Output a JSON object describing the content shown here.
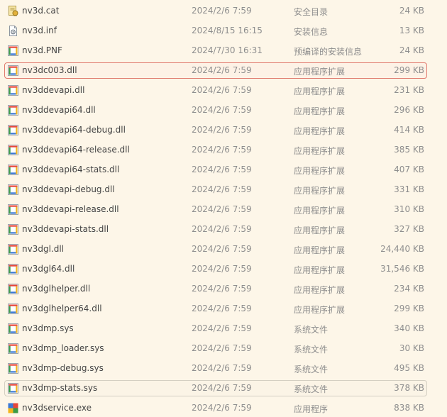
{
  "files": [
    {
      "name": "nv3d.cat",
      "date": "2024/2/6 7:59",
      "type": "安全目录",
      "size": "24 KB",
      "icon": "catalog-file-icon"
    },
    {
      "name": "nv3d.inf",
      "date": "2024/8/15 16:15",
      "type": "安装信息",
      "size": "13 KB",
      "icon": "setup-info-file-icon"
    },
    {
      "name": "nv3d.PNF",
      "date": "2024/7/30 16:31",
      "type": "预编译的安装信息",
      "size": "24 KB",
      "icon": "dll-file-icon"
    },
    {
      "name": "nv3dc003.dll",
      "date": "2024/2/6 7:59",
      "type": "应用程序扩展",
      "size": "299 KB",
      "icon": "dll-file-icon"
    },
    {
      "name": "nv3ddevapi.dll",
      "date": "2024/2/6 7:59",
      "type": "应用程序扩展",
      "size": "231 KB",
      "icon": "dll-file-icon"
    },
    {
      "name": "nv3ddevapi64.dll",
      "date": "2024/2/6 7:59",
      "type": "应用程序扩展",
      "size": "296 KB",
      "icon": "dll-file-icon"
    },
    {
      "name": "nv3ddevapi64-debug.dll",
      "date": "2024/2/6 7:59",
      "type": "应用程序扩展",
      "size": "414 KB",
      "icon": "dll-file-icon"
    },
    {
      "name": "nv3ddevapi64-release.dll",
      "date": "2024/2/6 7:59",
      "type": "应用程序扩展",
      "size": "385 KB",
      "icon": "dll-file-icon"
    },
    {
      "name": "nv3ddevapi64-stats.dll",
      "date": "2024/2/6 7:59",
      "type": "应用程序扩展",
      "size": "407 KB",
      "icon": "dll-file-icon"
    },
    {
      "name": "nv3ddevapi-debug.dll",
      "date": "2024/2/6 7:59",
      "type": "应用程序扩展",
      "size": "331 KB",
      "icon": "dll-file-icon"
    },
    {
      "name": "nv3ddevapi-release.dll",
      "date": "2024/2/6 7:59",
      "type": "应用程序扩展",
      "size": "310 KB",
      "icon": "dll-file-icon"
    },
    {
      "name": "nv3ddevapi-stats.dll",
      "date": "2024/2/6 7:59",
      "type": "应用程序扩展",
      "size": "327 KB",
      "icon": "dll-file-icon"
    },
    {
      "name": "nv3dgl.dll",
      "date": "2024/2/6 7:59",
      "type": "应用程序扩展",
      "size": "24,440 KB",
      "icon": "dll-file-icon"
    },
    {
      "name": "nv3dgl64.dll",
      "date": "2024/2/6 7:59",
      "type": "应用程序扩展",
      "size": "31,546 KB",
      "icon": "dll-file-icon"
    },
    {
      "name": "nv3dglhelper.dll",
      "date": "2024/2/6 7:59",
      "type": "应用程序扩展",
      "size": "234 KB",
      "icon": "dll-file-icon"
    },
    {
      "name": "nv3dglhelper64.dll",
      "date": "2024/2/6 7:59",
      "type": "应用程序扩展",
      "size": "299 KB",
      "icon": "dll-file-icon"
    },
    {
      "name": "nv3dmp.sys",
      "date": "2024/2/6 7:59",
      "type": "系统文件",
      "size": "340 KB",
      "icon": "dll-file-icon"
    },
    {
      "name": "nv3dmp_loader.sys",
      "date": "2024/2/6 7:59",
      "type": "系统文件",
      "size": "30 KB",
      "icon": "dll-file-icon"
    },
    {
      "name": "nv3dmp-debug.sys",
      "date": "2024/2/6 7:59",
      "type": "系统文件",
      "size": "495 KB",
      "icon": "dll-file-icon"
    },
    {
      "name": "nv3dmp-stats.sys",
      "date": "2024/2/6 7:59",
      "type": "系统文件",
      "size": "378 KB",
      "icon": "dll-file-icon"
    },
    {
      "name": "nv3dservice.exe",
      "date": "2024/2/6 7:59",
      "type": "应用程序",
      "size": "838 KB",
      "icon": "exe-file-icon"
    }
  ],
  "selected_file": "nv3dc003.dll",
  "focused_file": "nv3dmp-stats.sys",
  "colors": {
    "background": "#fdf6e8",
    "selection_border": "#e07a6e",
    "focus_border": "#d4cfc2",
    "name_text": "#444444",
    "detail_text": "#8e8e8e"
  }
}
